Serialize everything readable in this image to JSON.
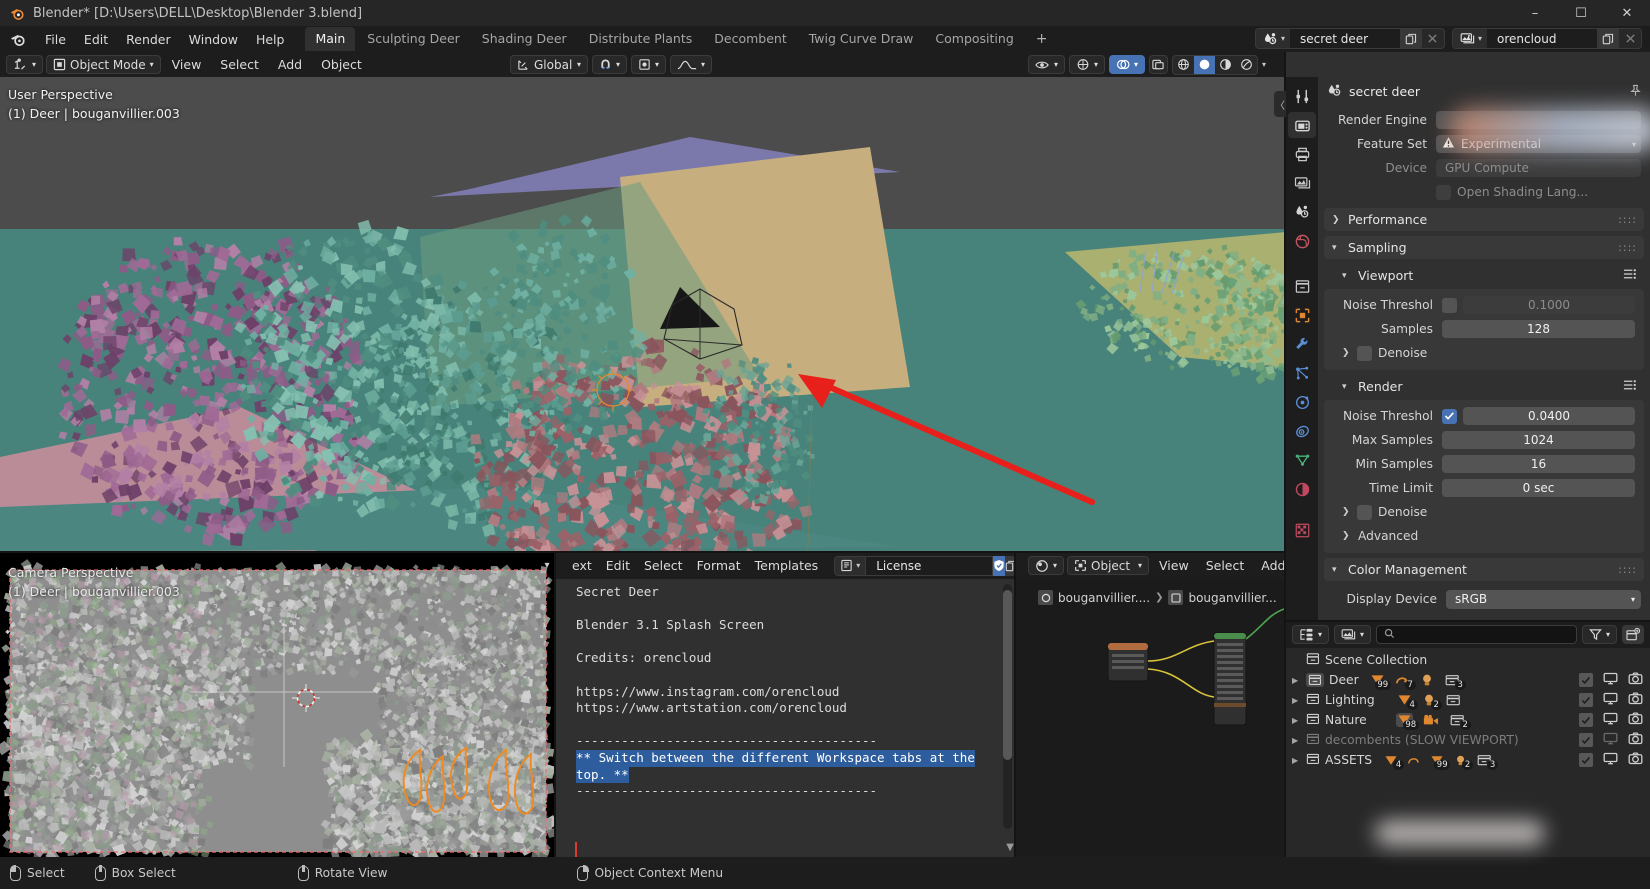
{
  "window": {
    "title": "Blender* [D:\\Users\\DELL\\Desktop\\Blender 3.blend]",
    "minimize": "–",
    "maximize": "☐",
    "close": "✕"
  },
  "menu": {
    "items": [
      "File",
      "Edit",
      "Render",
      "Window",
      "Help"
    ]
  },
  "workspace_tabs": [
    {
      "label": "Main",
      "active": true
    },
    {
      "label": "Sculpting Deer",
      "active": false
    },
    {
      "label": "Shading Deer",
      "active": false
    },
    {
      "label": "Distribute Plants",
      "active": false
    },
    {
      "label": "Decombent",
      "active": false
    },
    {
      "label": "Twig Curve Draw",
      "active": false
    },
    {
      "label": "Compositing",
      "active": false
    }
  ],
  "workspace_add": "+",
  "scene_selector": {
    "icon": "scene-icon",
    "value": "secret deer",
    "new_icon": "copy-icon",
    "unlink_icon": "x-icon"
  },
  "viewlayer_selector": {
    "icon": "viewlayer-icon",
    "value": "orencloud",
    "new_icon": "copy-icon",
    "remove_icon": "x-icon"
  },
  "viewport_header": {
    "editor_type": "editor-type-3dview",
    "mode": "Object Mode",
    "menus": [
      "View",
      "Select",
      "Add",
      "Object"
    ],
    "transform_orientation": "Global",
    "snap_icon": "magnet-icon",
    "proportional_icon": "proportional-edit-icon",
    "visibility_icon": "eye-icon",
    "gizmo_icon": "gizmo-icon",
    "overlays_icon": "overlays-icon",
    "xray_icon": "xray-icon",
    "shading_modes": [
      "wireframe",
      "solid",
      "material-preview",
      "rendered"
    ],
    "shading_active_index": 1
  },
  "viewport": {
    "perspective_label": "User Perspective",
    "object_label": "(1) Deer | bouganvillier.003"
  },
  "camera_view": {
    "perspective_label": "Camera Perspective",
    "object_label": "(1) Deer | bouganvillier.003"
  },
  "text_editor": {
    "menus": [
      "ext",
      "Edit",
      "Select",
      "Format",
      "Templates"
    ],
    "datablock_icon": "text-icon",
    "datablock_name": "License",
    "shield_icon": "shield-icon",
    "copy_icon": "copy-icon",
    "lines": [
      "Secret Deer",
      "",
      "Blender 3.1 Splash Screen",
      "",
      "Credits: orencloud",
      "",
      "https://www.instagram.com/orencloud",
      "https://www.artstation.com/orencloud",
      "",
      "----------------------------------------"
    ],
    "highlighted_line_1": "** Switch between the different Workspace tabs at the",
    "highlighted_line_2": "top. **",
    "trailing_line": "----------------------------------------"
  },
  "node_editor": {
    "editor_icon": "shader-editor-icon",
    "shader_type": "Object",
    "menus": [
      "View",
      "Select",
      "Add"
    ],
    "breadcrumb": [
      "bouganvillier....",
      "bouganvillier..."
    ]
  },
  "properties": {
    "search_placeholder": "",
    "search_icon": "search-icon",
    "editor_type_icon": "properties-editor-icon",
    "title": "secret deer",
    "title_icon": "scene-icon",
    "pin_icon": "pin-icon",
    "tabs": [
      "tool-icon",
      "render-icon",
      "output-icon",
      "viewlayer-icon",
      "scene-icon",
      "world-icon",
      "collection-icon",
      "object-icon",
      "modifier-icon",
      "particles-icon",
      "physics-icon",
      "constraint-icon",
      "data-icon",
      "material-icon",
      "texture-icon"
    ],
    "active_tab_index": 1,
    "rows": [
      {
        "label": "Render Engine",
        "value": "",
        "type": "redacted"
      },
      {
        "label": "Feature Set",
        "value": "Experimental",
        "type": "dropdown-warn"
      },
      {
        "label": "Device",
        "value": "GPU Compute",
        "type": "dropdown-dim"
      },
      {
        "label": "Open Shading Lang...",
        "value": "",
        "type": "checkbox-dim"
      }
    ],
    "performance_panel": "Performance",
    "sampling_panel": "Sampling",
    "viewport_subpanel": "Viewport",
    "viewport_rows": [
      {
        "label": "Noise Threshol",
        "value": "0.1000",
        "checked": false
      },
      {
        "label": "Samples",
        "value": "128"
      }
    ],
    "viewport_denoise": "Denoise",
    "render_subpanel": "Render",
    "render_rows": [
      {
        "label": "Noise Threshol",
        "value": "0.0400",
        "checked": true
      },
      {
        "label": "Max Samples",
        "value": "1024"
      },
      {
        "label": "Min Samples",
        "value": "16"
      },
      {
        "label": "Time Limit",
        "value": "0 sec"
      }
    ],
    "render_denoise": "Denoise",
    "advanced_panel": "Advanced",
    "color_management_panel": "Color Management",
    "display_device_label": "Display Device",
    "display_device_value": "sRGB"
  },
  "outliner": {
    "display_mode_icon": "outliner-display-mode-icon",
    "filter_id_icon": "id-type-icon",
    "search_placeholder": "",
    "search_icon": "search-icon",
    "filter_icon": "funnel-icon",
    "new_collection_icon": "new-collection-icon",
    "root": "Scene Collection",
    "rows": [
      {
        "name": "Deer",
        "dim": false,
        "badges": [
          {
            "icon": "mesh-icon",
            "count": "99",
            "plus": true
          },
          {
            "icon": "curve-icon",
            "count": "7"
          },
          {
            "icon": "light-icon",
            "count": ""
          },
          {
            "icon": "collection-icon",
            "count": "3"
          }
        ],
        "checked": true,
        "screen": true,
        "camera": true
      },
      {
        "name": "Lighting",
        "dim": false,
        "badges": [
          {
            "icon": "mesh-icon",
            "count": "4"
          },
          {
            "icon": "light-icon",
            "count": "2"
          },
          {
            "icon": "collection-icon",
            "count": ""
          }
        ],
        "checked": true,
        "screen": true,
        "camera": true
      },
      {
        "name": "Nature",
        "dim": false,
        "selected": true,
        "badges": [
          {
            "icon": "mesh-icon",
            "count": "98"
          },
          {
            "icon": "camera-icon",
            "count": ""
          },
          {
            "icon": "collection-icon",
            "count": "2"
          }
        ],
        "checked": true,
        "screen": true,
        "camera": true
      },
      {
        "name": "decombents (SLOW VIEWPORT)",
        "dim": true,
        "badges": [],
        "checked": true,
        "screen": false,
        "camera": true
      },
      {
        "name": "ASSETS",
        "dim": false,
        "badges": [
          {
            "icon": "mesh-icon",
            "count": "4"
          },
          {
            "icon": "curve-icon",
            "count": ""
          },
          {
            "icon": "mesh-icon",
            "count": "99",
            "plus": true
          },
          {
            "icon": "light-icon",
            "count": "2"
          },
          {
            "icon": "collection-icon",
            "count": "3"
          }
        ],
        "checked": true,
        "screen": true,
        "camera": true
      }
    ]
  },
  "status_bar": [
    {
      "icon": "mouse-left-icon",
      "label": "Select"
    },
    {
      "icon": "mouse-middle-icon",
      "label": "Box Select"
    },
    {
      "icon": "mouse-middle-icon",
      "label": "Rotate View"
    },
    {
      "icon": "mouse-right-icon",
      "label": "Object Context Menu"
    }
  ],
  "annotation": {
    "arrow_color": "#e8201b"
  }
}
